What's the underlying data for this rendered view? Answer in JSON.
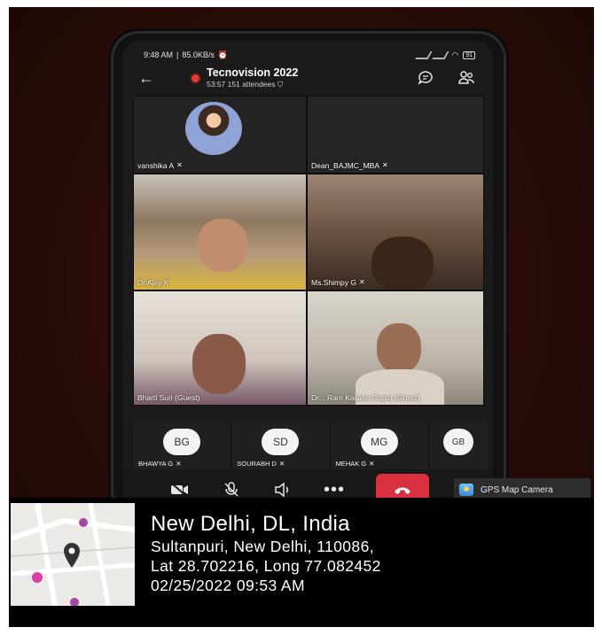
{
  "status_bar": {
    "time": "9:48 AM",
    "speed": "85.0KB/s",
    "battery": "91"
  },
  "meeting": {
    "title": "Tecnovision 2022",
    "duration": "53:57",
    "attendees": "151 attendees"
  },
  "participants": [
    {
      "name": "vanshika A",
      "muted": true
    },
    {
      "name": "Dean_BAJMC_MBA",
      "muted": true
    },
    {
      "name": "Dr.Ajay K",
      "muted": false
    },
    {
      "name": "Ms.Shimpy G",
      "muted": true
    },
    {
      "name": "Bharti Suri (Guest)",
      "muted": false
    },
    {
      "name": "Dr. . Ram Kailash Gupta (Guest)",
      "muted": false
    }
  ],
  "bottom_participants": [
    {
      "initials": "BG",
      "name": "BHAWYA G"
    },
    {
      "initials": "SD",
      "name": "SOURABH D"
    },
    {
      "initials": "MG",
      "name": "MEHAK G"
    },
    {
      "initials": "GB",
      "name": ""
    }
  ],
  "controls": [
    "camera-off",
    "mic-off",
    "speaker",
    "more",
    "end-call"
  ],
  "gps_badge": "GPS Map Camera",
  "location": {
    "place": "New Delhi, DL, India",
    "address": "Sultanpuri, New Delhi, 110086,",
    "coords": "Lat 28.702216, Long 77.082452",
    "datetime": "02/25/2022 09:53 AM"
  },
  "colors": {
    "end_call": "#d92f3e",
    "record": "#e53935"
  }
}
